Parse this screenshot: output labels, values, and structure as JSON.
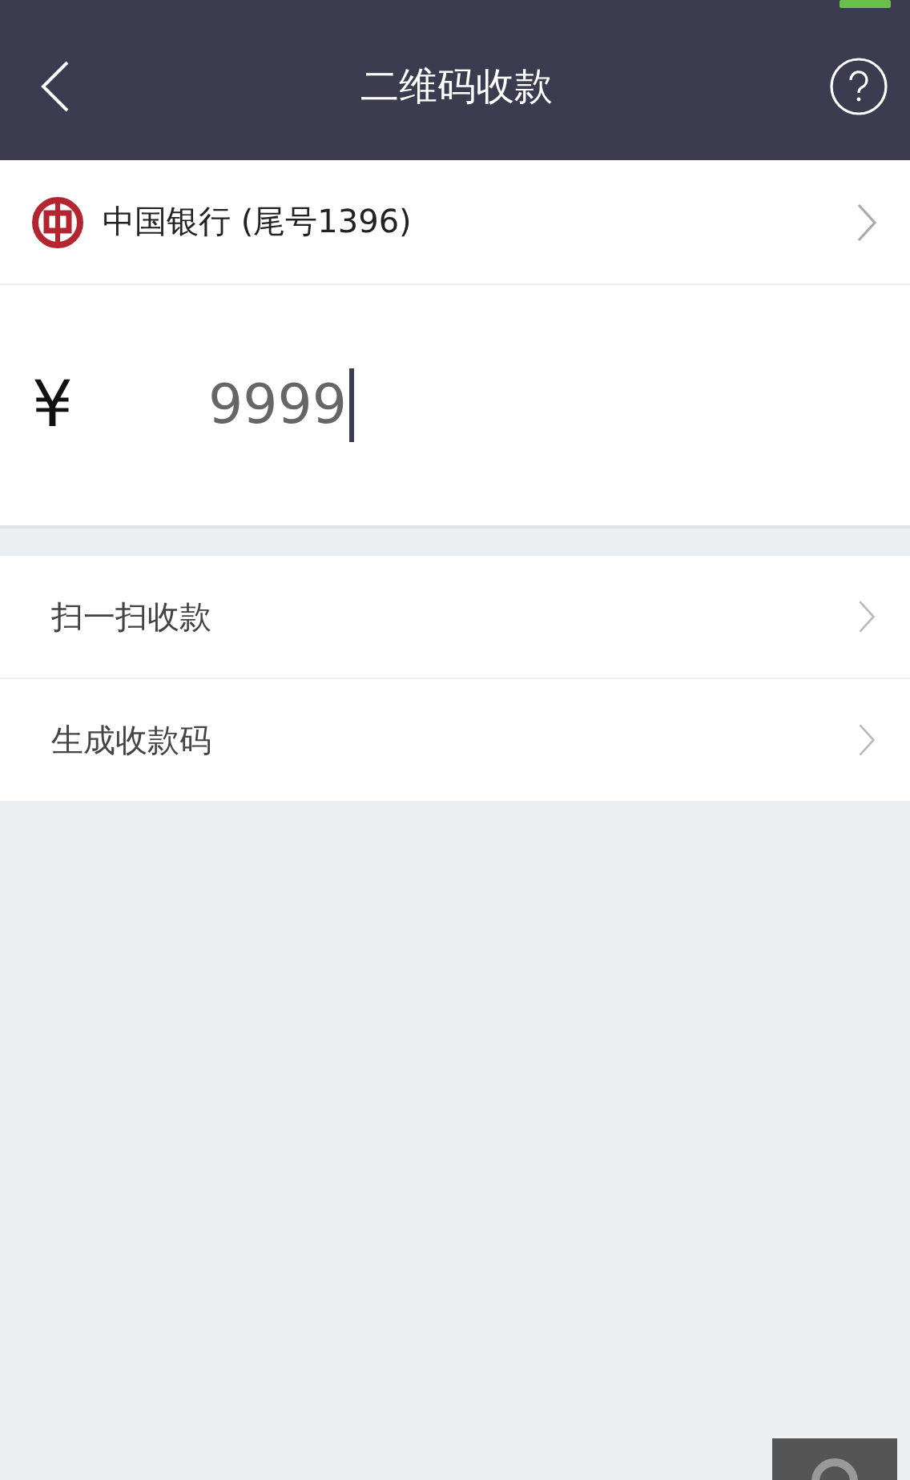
{
  "header": {
    "title": "二维码收款"
  },
  "account": {
    "bank": "中国银行",
    "tail": "(尾号1396)"
  },
  "amount": {
    "currency": "¥",
    "value": "9999"
  },
  "menu": [
    {
      "label": "扫一扫收款"
    },
    {
      "label": "生成收款码"
    }
  ]
}
